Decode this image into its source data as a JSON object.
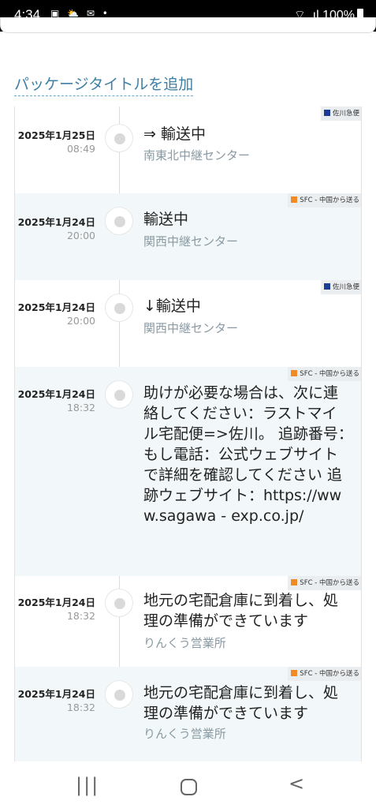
{
  "status_bar": {
    "time": "4:34",
    "left_icons": "▣ ⛅ ✉ •",
    "right_icons": "⌔ .ıl",
    "battery_text": "100%"
  },
  "package_title_link": "パッケージタイトルを追加",
  "events": [
    {
      "date": "2025年1月25日",
      "time": "08:49",
      "status": "⇒ 輸送中",
      "location": "南東北中継センター",
      "carrier": "佐川急便",
      "carrier_color": "blue",
      "alt": false
    },
    {
      "date": "2025年1月24日",
      "time": "20:00",
      "status": "輸送中",
      "location": "関西中継センター",
      "carrier": "SFC - 中国から送る",
      "carrier_color": "orange",
      "alt": true
    },
    {
      "date": "2025年1月24日",
      "time": "20:00",
      "status": "↓輸送中",
      "location": "関西中継センター",
      "carrier": "佐川急便",
      "carrier_color": "blue",
      "alt": false
    },
    {
      "date": "2025年1月24日",
      "time": "18:32",
      "status": "助けが必要な場合は、次に連絡してください：ラストマイル宅配便=>佐川。 追跡番号：　　　　　　もし電話：公式ウェブサイトで詳細を確認してください 追跡ウェブサイト：https://www.sagawa - exp.co.jp/",
      "location": "",
      "carrier": "SFC - 中国から送る",
      "carrier_color": "orange",
      "alt": true
    },
    {
      "date": "2025年1月24日",
      "time": "18:32",
      "status": "地元の宅配倉庫に到着し、処理の準備ができています",
      "location": "りんくう営業所",
      "carrier": "SFC - 中国から送る",
      "carrier_color": "orange",
      "alt": false
    },
    {
      "date": "2025年1月24日",
      "time": "18:32",
      "status": "地元の宅配倉庫に到着し、処理の準備ができています",
      "location": "りんくう営業所",
      "carrier": "SFC - 中国から送る",
      "carrier_color": "orange",
      "alt": true
    }
  ],
  "nav": {
    "recent": "|||",
    "back": "<"
  }
}
